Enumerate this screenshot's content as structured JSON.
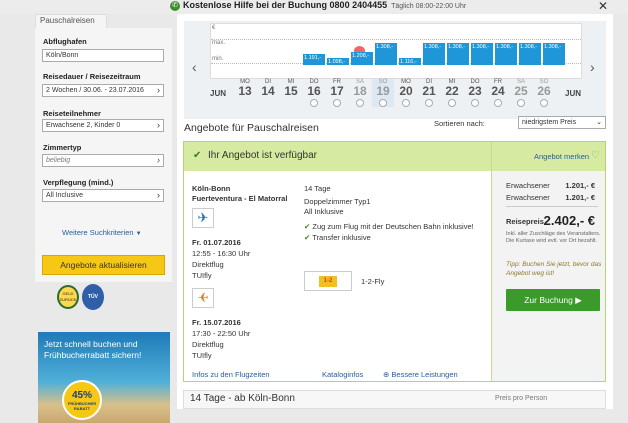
{
  "topbar": {
    "phone_text": "Kostenlose Hilfe bei der Buchung",
    "phone_number": "0800 2404455",
    "hours": "Täglich 08:00-22:00 Uhr"
  },
  "sidebar": {
    "tab": "Pauschalreisen",
    "departure_label": "Abflughafen",
    "departure_value": "Köln/Bonn",
    "duration_label": "Reisedauer / Reisezeitraum",
    "duration_value": "2 Wochen / 30.06. - 23.07.2016",
    "travelers_label": "Reiseteilnehmer",
    "travelers_value": "Erwachsene 2, Kinder 0",
    "room_label": "Zimmertyp",
    "room_value": "beliebig",
    "board_label": "Verpflegung (mind.)",
    "board_value": "All Inclusive",
    "more_criteria": "Weitere Suchkriterien",
    "update_button": "Angebote aktualisieren",
    "promo_text": "Jetzt schnell buchen und Frühbucherrabatt sichern!",
    "promo_pct": "45%",
    "promo_sub": "FRÜHBUCHER RABATT"
  },
  "calendar": {
    "axis_max": "max.",
    "axis_min": "min.",
    "axis_cur": "€",
    "month_left": "JUN",
    "month_right": "JUN",
    "bar_labels": [
      "1.191,-",
      "1.098,-",
      "1.208,-",
      "1.308,-",
      "1.116,-",
      "1.308,-",
      "1.308,-",
      "1.308,-",
      "1.308,-",
      "1.308,-",
      "1.308,-"
    ],
    "days": [
      {
        "dw": "MO",
        "dn": "13"
      },
      {
        "dw": "DI",
        "dn": "14"
      },
      {
        "dw": "MI",
        "dn": "15"
      },
      {
        "dw": "DO",
        "dn": "16"
      },
      {
        "dw": "FR",
        "dn": "17"
      },
      {
        "dw": "SA",
        "dn": "18"
      },
      {
        "dw": "SO",
        "dn": "19"
      },
      {
        "dw": "MO",
        "dn": "20"
      },
      {
        "dw": "DI",
        "dn": "21"
      },
      {
        "dw": "MI",
        "dn": "22"
      },
      {
        "dw": "DO",
        "dn": "23"
      },
      {
        "dw": "FR",
        "dn": "24"
      },
      {
        "dw": "SA",
        "dn": "25"
      },
      {
        "dw": "SO",
        "dn": "26"
      }
    ]
  },
  "main": {
    "heading": "Angebote für Pauschalreisen",
    "sort_label": "Sortieren nach:",
    "sort_value": "niedrigstem Preis"
  },
  "offer": {
    "available": "Ihr Angebot ist verfügbar",
    "bookmark": "Angebot merken",
    "route": "Köln-Bonn",
    "destination": "Fuerteventura - El Matorral",
    "out_date": "Fr. 01.07.2016",
    "out_time": "12:55 - 16:30 Uhr",
    "out_type": "Direktflug",
    "out_airline": "TUIfly",
    "ret_date": "Fr. 15.07.2016",
    "ret_time": "17:30 - 22:50 Uhr",
    "ret_type": "Direktflug",
    "ret_airline": "TUIfly",
    "flight_info": "Infos zu den Flugzeiten",
    "duration": "14 Tage",
    "room": "Doppelzimmer Typ1",
    "board": "All Inklusive",
    "train": "Zug zum Flug mit der Deutschen Bahn inklusive!",
    "transfer": "Transfer inklusive",
    "operator": "1-2-Fly",
    "catalog_info": "Kataloginfos",
    "better": "Bessere Leistungen",
    "adult1_label": "Erwachsener",
    "adult1_price": "1.201,- €",
    "adult2_label": "Erwachsener",
    "adult2_price": "1.201,- €",
    "total_label": "Reisepreis",
    "total_price": "2.402,- €",
    "note": "Inkl. aller Zuschläge des Veranstalters. Die Kurtaxe wird evtl. vor Ort bezahlt.",
    "tip": "Tipp: Buchen Sie jetzt, bevor das Angebot weg ist!",
    "book_button": "Zur Buchung"
  },
  "next": {
    "title": "14 Tage - ab Köln-Bonn",
    "price_label": "Preis pro Person"
  }
}
